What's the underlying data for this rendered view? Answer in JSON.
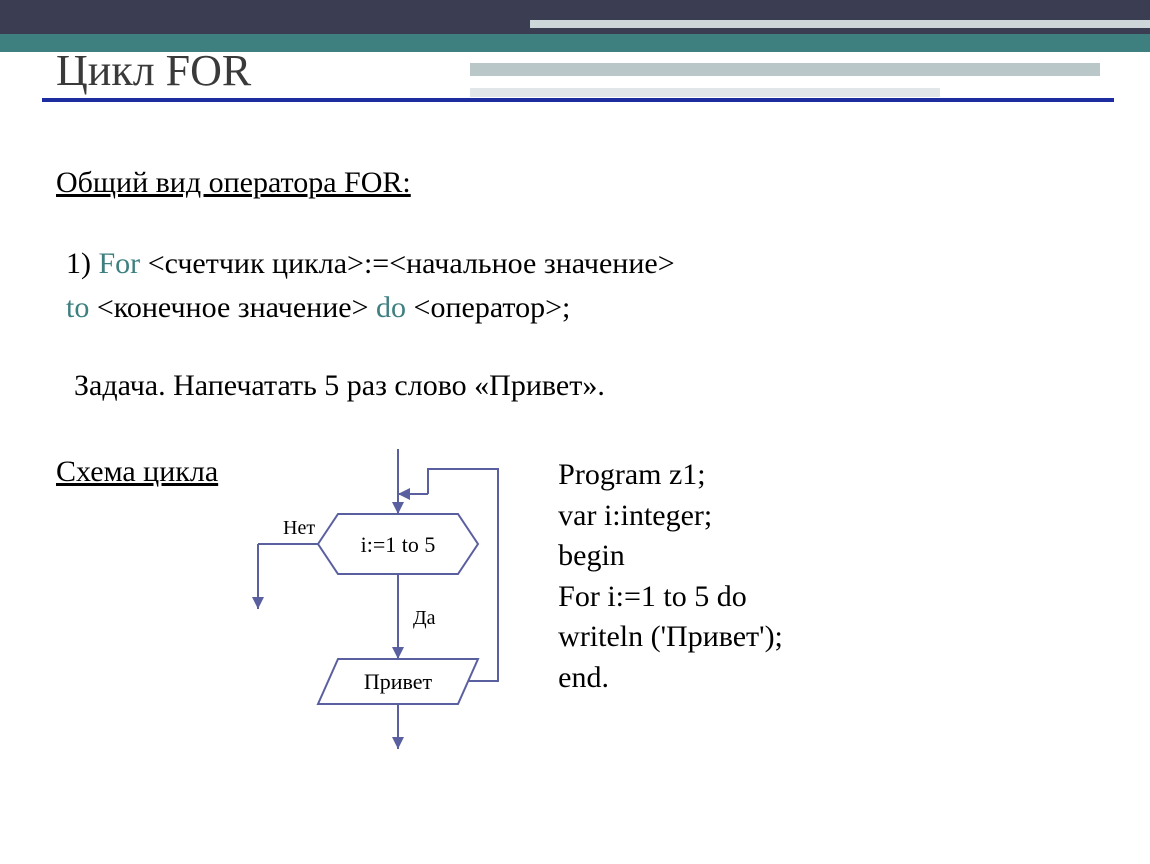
{
  "title": "Цикл FOR",
  "subheading": "Общий вид оператора FOR:",
  "syntax": {
    "n": "1) ",
    "for": "For",
    "part1": " <счетчик цикла>:=<начальное значение>",
    "to": "to",
    "part2": " <конечное значение> ",
    "do": "do",
    "part3": " <оператор>;"
  },
  "task": "Задача. Напечатать 5 раз слово «Привет».",
  "scheme_label": "Схема цикла",
  "diagram": {
    "no": "Нет",
    "cond": "i:=1 to 5",
    "yes": "Да",
    "body": "Привет"
  },
  "code": {
    "l1": "Program z1;",
    "l2": "var i:integer;",
    "l3": "begin",
    "l4": "For i:=1 to 5 do",
    "l5": "writeln ('Привет');",
    "l6": "end."
  }
}
